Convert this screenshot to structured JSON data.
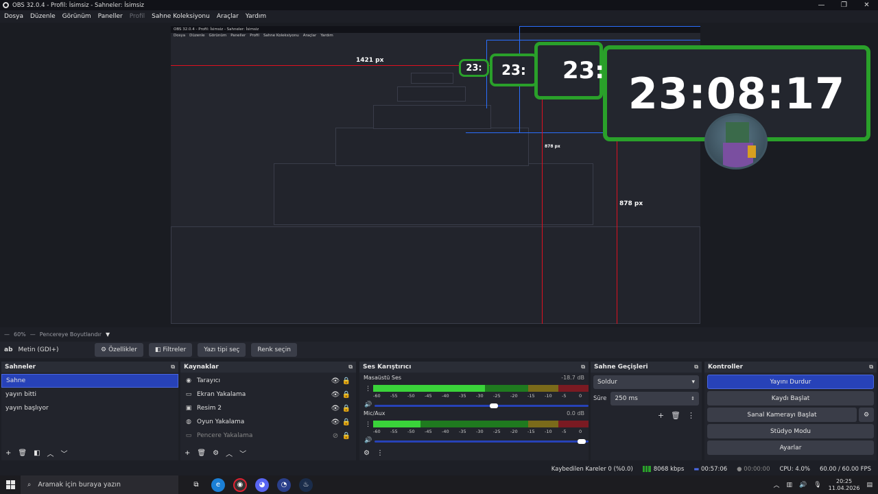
{
  "window": {
    "title": "OBS 32.0.4 - Profil: İsimsiz - Sahneler: İsimsiz",
    "min": "—",
    "max": "❐",
    "close": "✕"
  },
  "menu": {
    "items": [
      "Dosya",
      "Düzenle",
      "Görünüm",
      "Paneller",
      "Profil",
      "Sahne Koleksiyonu",
      "Araçlar",
      "Yardım"
    ]
  },
  "preview": {
    "label_width": "1421 px",
    "label_height_small": "878 px",
    "label_height_big": "878 px",
    "clock_text": "23:08:17",
    "clock_partial_1": "23:",
    "clock_partial_2": "23:",
    "clock_partial_3": "23:"
  },
  "zoom_bar": {
    "zoom": "60%",
    "mode": "Pencereye Boyutlandır"
  },
  "source_toolbar": {
    "source_name": "Metin (GDI+)",
    "buttons": [
      "Özellikler",
      "Filtreler",
      "Yazı tipi seç",
      "Renk seçin"
    ]
  },
  "scenes": {
    "title": "Sahneler",
    "items": [
      "Sahne",
      "yayın bitti",
      "yayın başlıyor"
    ],
    "selected_index": 0
  },
  "sources": {
    "title": "Kaynaklar",
    "items": [
      {
        "name": "Tarayıcı",
        "icon": "globe-icon",
        "visible": true
      },
      {
        "name": "Ekran Yakalama",
        "icon": "monitor-icon",
        "visible": true
      },
      {
        "name": "Resim 2",
        "icon": "image-icon",
        "visible": true
      },
      {
        "name": "Oyun Yakalama",
        "icon": "gamepad-icon",
        "visible": true
      },
      {
        "name": "Pencere Yakalama",
        "icon": "window-icon",
        "visible": false
      }
    ]
  },
  "mixer": {
    "title": "Ses Karıştırıcı",
    "channels": [
      {
        "name": "Masaüstü Ses",
        "db": "-18.7 dB",
        "level": 0.55
      },
      {
        "name": "Mic/Aux",
        "db": "0.0 dB",
        "level": 1.0
      }
    ],
    "scale": [
      "-60",
      "-55",
      "-50",
      "-45",
      "-40",
      "-35",
      "-30",
      "-25",
      "-20",
      "-15",
      "-10",
      "-5",
      "0"
    ]
  },
  "transitions": {
    "title": "Sahne Geçişleri",
    "selected": "Soldur",
    "duration_label": "Süre",
    "duration_value": "250 ms"
  },
  "controls": {
    "title": "Kontroller",
    "buttons": [
      "Yayını Durdur",
      "Kaydı Başlat",
      "Sanal Kamerayı Başlat",
      "Stüdyo Modu",
      "Ayarlar"
    ]
  },
  "status": {
    "dropped": "Kaybedilen Kareler 0 (%0.0)",
    "bitrate": "8068 kbps",
    "stream_time": "00:57:06",
    "rec_time": "00:00:00",
    "cpu": "CPU: 4.0%",
    "fps": "60.00 / 60.00 FPS"
  },
  "taskbar": {
    "search_placeholder": "Aramak için buraya yazın",
    "time": "20:25",
    "date": "11.04.2026"
  },
  "colors": {
    "accent": "#2742b8",
    "clock_border": "#2aa02a",
    "guide_red": "#e01020",
    "guide_blue": "#2a6fff"
  }
}
